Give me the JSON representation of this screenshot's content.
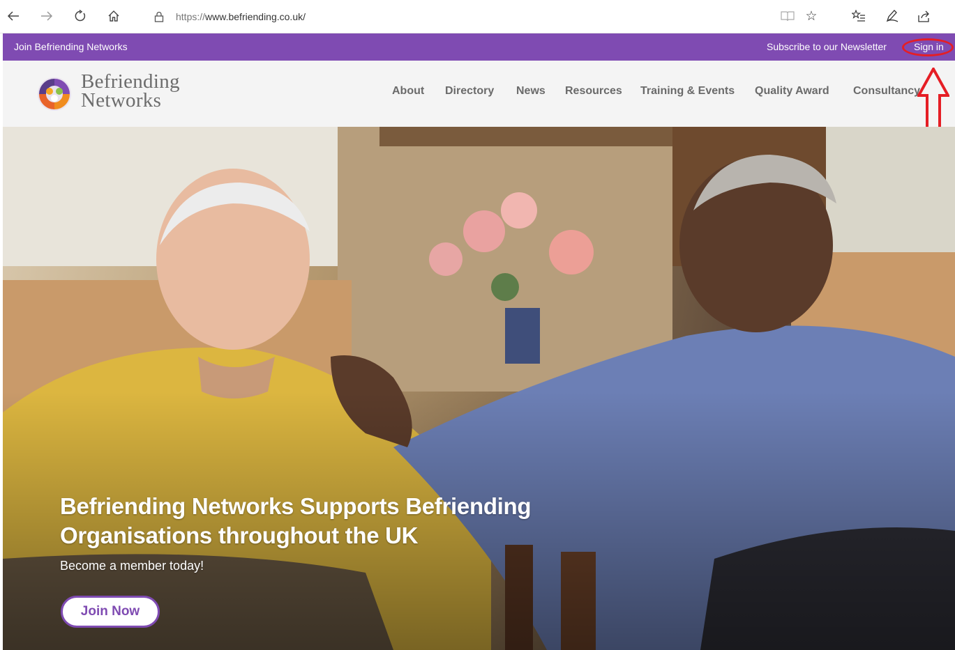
{
  "browser": {
    "url_proto": "https://",
    "url_rest": "www.befriending.co.uk/",
    "icons": [
      "back-icon",
      "forward-icon",
      "refresh-icon",
      "home-icon",
      "lock-icon",
      "reading-view-icon",
      "favorite-icon",
      "favorites-list-icon",
      "pen-icon",
      "share-icon"
    ]
  },
  "top_strip": {
    "join_label": "Join Befriending Networks",
    "subscribe_label": "Subscribe to our Newsletter",
    "signin_label": "Sign in",
    "background": "#7f4bb2",
    "annotation_color": "#e51e25"
  },
  "header": {
    "logo_line1": "Befriending",
    "logo_line2": "Networks",
    "nav": [
      "About",
      "Directory",
      "News",
      "Resources",
      "Training & Events",
      "Quality Award",
      "Consultancy"
    ]
  },
  "hero": {
    "title_line1": "Befriending Networks Supports Befriending",
    "title_line2": "Organisations throughout the UK",
    "subtitle": "Become a member today!",
    "cta_label": "Join Now",
    "accent": "#7f4bb2"
  }
}
